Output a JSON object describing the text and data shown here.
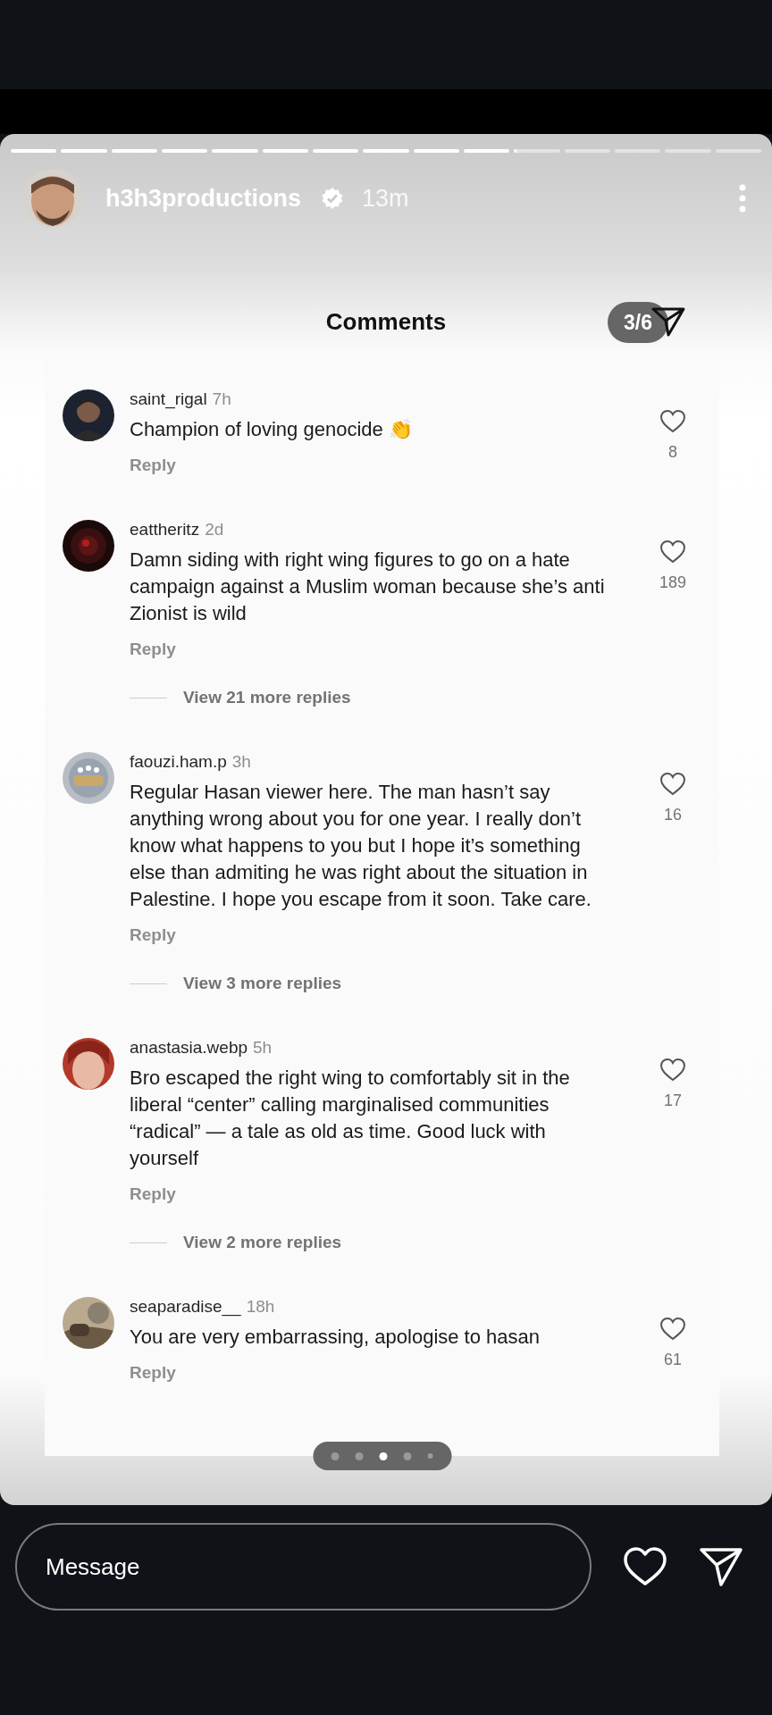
{
  "story": {
    "progress": [
      {
        "level": 1
      },
      {
        "level": 1
      },
      {
        "level": 1
      },
      {
        "level": 1
      },
      {
        "level": 1
      },
      {
        "level": 1
      },
      {
        "level": 1
      },
      {
        "level": 1
      },
      {
        "level": 1
      },
      {
        "level": 1
      },
      {
        "level": 0.06
      },
      {
        "level": 0
      },
      {
        "level": 0
      },
      {
        "level": 0
      },
      {
        "level": 0
      }
    ],
    "author": "h3h3productions",
    "verified": true,
    "time": "13m"
  },
  "post": {
    "title": "Comments",
    "page_counter": "3/6",
    "comments": [
      {
        "user": "saint_rigal",
        "time": "7h",
        "text": "Champion of loving genocide 👏",
        "reply": "Reply",
        "likes": "8"
      },
      {
        "user": "eattheritz",
        "time": "2d",
        "text": "Damn siding with right wing figures to go on a hate campaign against a Muslim woman because she’s anti Zionist is wild",
        "reply": "Reply",
        "likes": "189",
        "view_more": "View 21 more replies"
      },
      {
        "user": "faouzi.ham.p",
        "time": "3h",
        "text": "Regular Hasan viewer here. The man hasn’t say anything wrong about you for one year. I really don’t know what happens to you but I hope it’s something else than admiting he was right about the situation in Palestine. I hope you escape from it soon. Take care.",
        "reply": "Reply",
        "likes": "16",
        "view_more": "View 3 more replies"
      },
      {
        "user": "anastasia.webp",
        "time": "5h",
        "text": "Bro escaped the right wing to comfortably sit in the liberal “center” calling marginalised communities “radical” — a tale as old as time. Good luck with yourself",
        "reply": "Reply",
        "likes": "17",
        "view_more": "View 2 more replies"
      },
      {
        "user": "seaparadise__",
        "time": "18h",
        "text": "You are very embarrassing, apologise to hasan",
        "reply": "Reply",
        "likes": "61"
      }
    ],
    "carousel_dots": [
      {
        "selected": false
      },
      {
        "selected": false
      },
      {
        "selected": true
      },
      {
        "selected": false
      },
      {
        "selected": false
      }
    ]
  },
  "composer": {
    "placeholder": "Message"
  }
}
